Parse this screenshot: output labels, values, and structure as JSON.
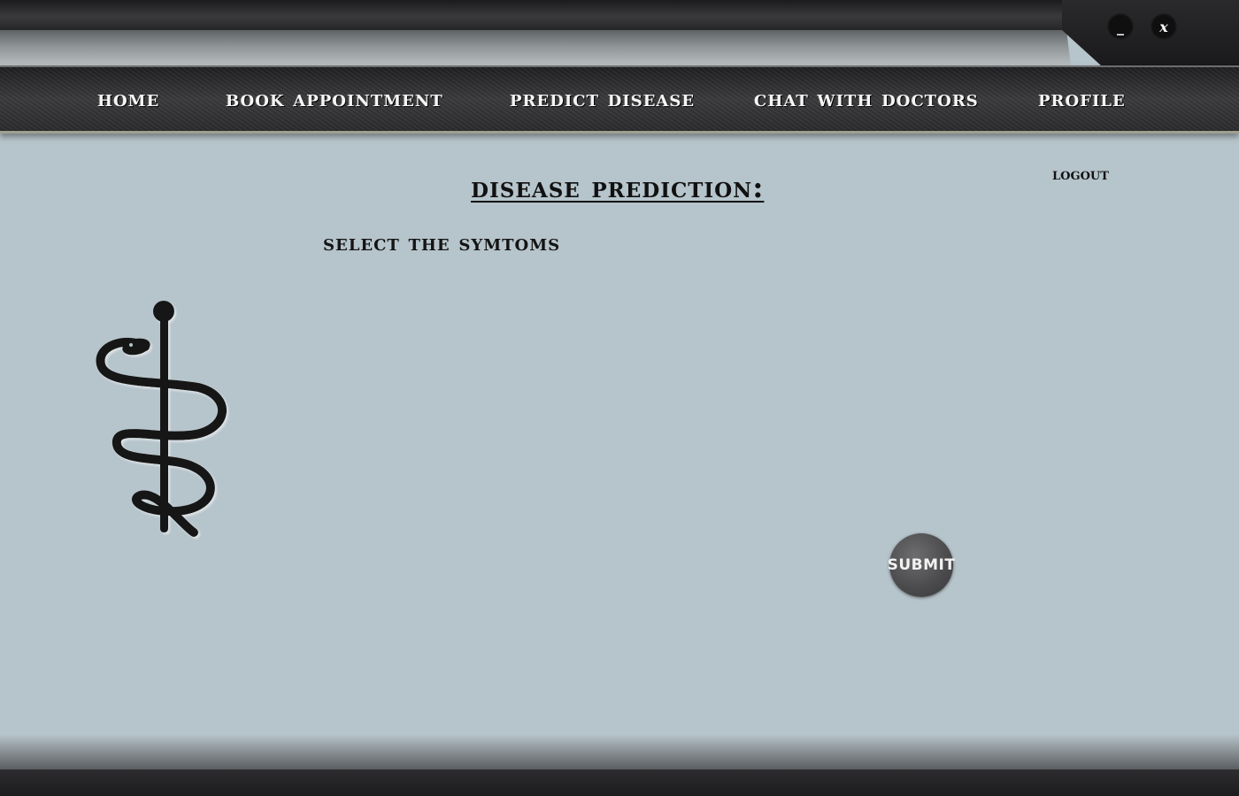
{
  "window": {
    "minimize_label": "_",
    "close_label": "x"
  },
  "nav": {
    "items": [
      {
        "label": "Home"
      },
      {
        "label": "Book Appointment"
      },
      {
        "label": "Predict Disease"
      },
      {
        "label": "Chat with Doctors"
      },
      {
        "label": "Profile"
      }
    ]
  },
  "main": {
    "title": "Disease Prediction:",
    "logout_label": "Logout",
    "select_label": "Select the symtoms",
    "submit_label": "Submit",
    "logo_icon": "rod-of-asclepius-icon"
  },
  "colors": {
    "background": "#b6c4cb",
    "nav_background": "#2a2a2c",
    "nav_text": "#f5f5f5",
    "text_dark": "#111111",
    "submit_button": "#4a4a4c"
  }
}
